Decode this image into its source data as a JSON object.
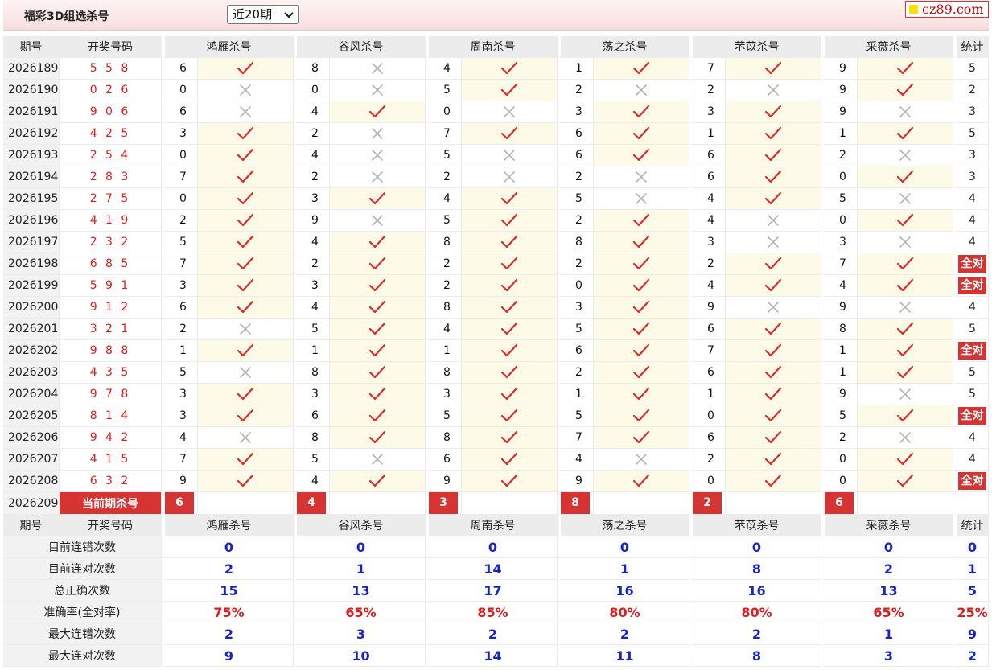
{
  "header": {
    "title": "福彩3D组选杀号",
    "period_select": "近20期",
    "brand": "cz89.com"
  },
  "columns": {
    "issue": "期号",
    "draw": "开奖号码",
    "experts": [
      "鸿雁杀号",
      "谷风杀号",
      "周南杀号",
      "荡之杀号",
      "芣苡杀号",
      "采薇杀号"
    ],
    "stat": "统计"
  },
  "rows": [
    {
      "issue": "2026189",
      "draw": "5 5 8",
      "kills": [
        [
          6,
          1
        ],
        [
          8,
          0
        ],
        [
          4,
          1
        ],
        [
          1,
          1
        ],
        [
          7,
          1
        ],
        [
          9,
          1
        ]
      ],
      "stat": "5"
    },
    {
      "issue": "2026190",
      "draw": "0 2 6",
      "kills": [
        [
          0,
          0
        ],
        [
          0,
          0
        ],
        [
          5,
          1
        ],
        [
          2,
          0
        ],
        [
          2,
          0
        ],
        [
          9,
          1
        ]
      ],
      "stat": "2"
    },
    {
      "issue": "2026191",
      "draw": "9 0 6",
      "kills": [
        [
          6,
          0
        ],
        [
          4,
          1
        ],
        [
          0,
          0
        ],
        [
          3,
          1
        ],
        [
          3,
          1
        ],
        [
          9,
          0
        ]
      ],
      "stat": "3"
    },
    {
      "issue": "2026192",
      "draw": "4 2 5",
      "kills": [
        [
          3,
          1
        ],
        [
          2,
          0
        ],
        [
          7,
          1
        ],
        [
          6,
          1
        ],
        [
          1,
          1
        ],
        [
          1,
          1
        ]
      ],
      "stat": "5"
    },
    {
      "issue": "2026193",
      "draw": "2 5 4",
      "kills": [
        [
          0,
          1
        ],
        [
          4,
          0
        ],
        [
          5,
          0
        ],
        [
          6,
          1
        ],
        [
          6,
          1
        ],
        [
          2,
          0
        ]
      ],
      "stat": "3"
    },
    {
      "issue": "2026194",
      "draw": "2 8 3",
      "kills": [
        [
          7,
          1
        ],
        [
          2,
          0
        ],
        [
          2,
          0
        ],
        [
          2,
          0
        ],
        [
          6,
          1
        ],
        [
          0,
          1
        ]
      ],
      "stat": "3"
    },
    {
      "issue": "2026195",
      "draw": "2 7 5",
      "kills": [
        [
          0,
          1
        ],
        [
          3,
          1
        ],
        [
          4,
          1
        ],
        [
          5,
          0
        ],
        [
          4,
          1
        ],
        [
          5,
          0
        ]
      ],
      "stat": "4"
    },
    {
      "issue": "2026196",
      "draw": "4 1 9",
      "kills": [
        [
          2,
          1
        ],
        [
          9,
          0
        ],
        [
          5,
          1
        ],
        [
          2,
          1
        ],
        [
          4,
          0
        ],
        [
          0,
          1
        ]
      ],
      "stat": "4"
    },
    {
      "issue": "2026197",
      "draw": "2 3 2",
      "kills": [
        [
          5,
          1
        ],
        [
          4,
          1
        ],
        [
          8,
          1
        ],
        [
          8,
          1
        ],
        [
          3,
          0
        ],
        [
          3,
          0
        ]
      ],
      "stat": "4"
    },
    {
      "issue": "2026198",
      "draw": "6 8 5",
      "kills": [
        [
          7,
          1
        ],
        [
          2,
          1
        ],
        [
          2,
          1
        ],
        [
          2,
          1
        ],
        [
          2,
          1
        ],
        [
          7,
          1
        ]
      ],
      "stat": "全对"
    },
    {
      "issue": "2026199",
      "draw": "5 9 1",
      "kills": [
        [
          3,
          1
        ],
        [
          3,
          1
        ],
        [
          2,
          1
        ],
        [
          0,
          1
        ],
        [
          4,
          1
        ],
        [
          4,
          1
        ]
      ],
      "stat": "全对"
    },
    {
      "issue": "2026200",
      "draw": "9 1 2",
      "kills": [
        [
          6,
          1
        ],
        [
          4,
          1
        ],
        [
          8,
          1
        ],
        [
          3,
          1
        ],
        [
          9,
          0
        ],
        [
          9,
          0
        ]
      ],
      "stat": "4"
    },
    {
      "issue": "2026201",
      "draw": "3 2 1",
      "kills": [
        [
          2,
          0
        ],
        [
          5,
          1
        ],
        [
          4,
          1
        ],
        [
          5,
          1
        ],
        [
          6,
          1
        ],
        [
          8,
          1
        ]
      ],
      "stat": "5"
    },
    {
      "issue": "2026202",
      "draw": "9 8 8",
      "kills": [
        [
          1,
          1
        ],
        [
          1,
          1
        ],
        [
          1,
          1
        ],
        [
          6,
          1
        ],
        [
          7,
          1
        ],
        [
          1,
          1
        ]
      ],
      "stat": "全对"
    },
    {
      "issue": "2026203",
      "draw": "4 3 5",
      "kills": [
        [
          5,
          0
        ],
        [
          8,
          1
        ],
        [
          8,
          1
        ],
        [
          2,
          1
        ],
        [
          6,
          1
        ],
        [
          1,
          1
        ]
      ],
      "stat": "5"
    },
    {
      "issue": "2026204",
      "draw": "9 7 8",
      "kills": [
        [
          3,
          1
        ],
        [
          3,
          1
        ],
        [
          3,
          1
        ],
        [
          1,
          1
        ],
        [
          1,
          1
        ],
        [
          9,
          0
        ]
      ],
      "stat": "5"
    },
    {
      "issue": "2026205",
      "draw": "8 1 4",
      "kills": [
        [
          3,
          1
        ],
        [
          6,
          1
        ],
        [
          5,
          1
        ],
        [
          5,
          1
        ],
        [
          0,
          1
        ],
        [
          5,
          1
        ]
      ],
      "stat": "全对"
    },
    {
      "issue": "2026206",
      "draw": "9 4 2",
      "kills": [
        [
          4,
          0
        ],
        [
          8,
          1
        ],
        [
          8,
          1
        ],
        [
          7,
          1
        ],
        [
          6,
          1
        ],
        [
          2,
          0
        ]
      ],
      "stat": "4"
    },
    {
      "issue": "2026207",
      "draw": "4 1 5",
      "kills": [
        [
          7,
          1
        ],
        [
          5,
          0
        ],
        [
          6,
          1
        ],
        [
          4,
          0
        ],
        [
          2,
          1
        ],
        [
          0,
          1
        ]
      ],
      "stat": "4"
    },
    {
      "issue": "2026208",
      "draw": "6 3 2",
      "kills": [
        [
          9,
          1
        ],
        [
          4,
          1
        ],
        [
          9,
          1
        ],
        [
          9,
          1
        ],
        [
          0,
          1
        ],
        [
          0,
          1
        ]
      ],
      "stat": "全对"
    }
  ],
  "current": {
    "issue": "2026209",
    "label": "当前期杀号",
    "kills": [
      "6",
      "4",
      "3",
      "8",
      "2",
      "6"
    ]
  },
  "summary": [
    {
      "label": "目前连错次数",
      "values": [
        "0",
        "0",
        "0",
        "0",
        "0",
        "0"
      ],
      "stat": "0",
      "red": false
    },
    {
      "label": "目前连对次数",
      "values": [
        "2",
        "1",
        "14",
        "1",
        "8",
        "2"
      ],
      "stat": "1",
      "red": false
    },
    {
      "label": "总正确次数",
      "values": [
        "15",
        "13",
        "17",
        "16",
        "16",
        "13"
      ],
      "stat": "5",
      "red": false
    },
    {
      "label": "准确率(全对率)",
      "values": [
        "75%",
        "65%",
        "85%",
        "80%",
        "80%",
        "65%"
      ],
      "stat": "25%",
      "red": true
    },
    {
      "label": "最大连错次数",
      "values": [
        "2",
        "3",
        "2",
        "2",
        "2",
        "1"
      ],
      "stat": "9",
      "red": false
    },
    {
      "label": "最大连对次数",
      "values": [
        "9",
        "10",
        "14",
        "11",
        "8",
        "3"
      ],
      "stat": "2",
      "red": false
    }
  ],
  "colors": {
    "accent_red": "#d63333",
    "check_red": "#e02828",
    "cross_gray": "#b4b4b4",
    "value_blue": "#1722c8",
    "header_gray": "#ececec"
  },
  "icons": {
    "correct": "check-icon",
    "wrong": "cross-icon"
  }
}
